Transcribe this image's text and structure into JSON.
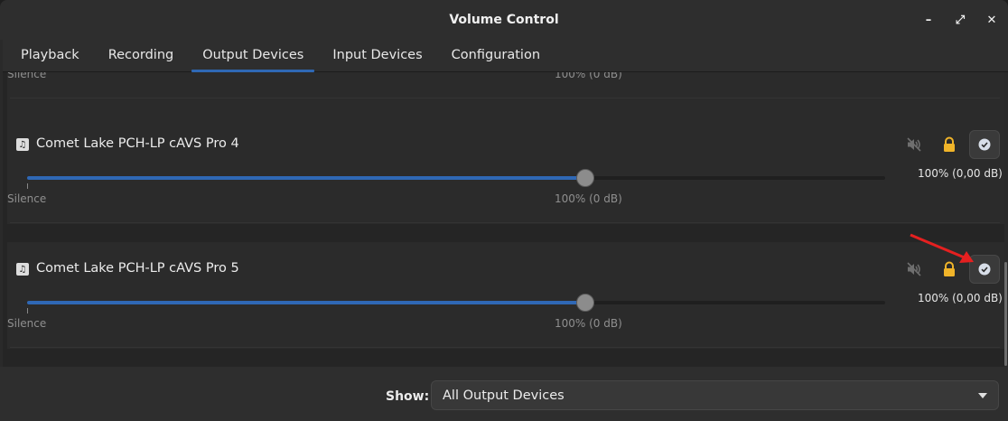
{
  "window": {
    "title": "Volume Control",
    "minimize_glyph": "–",
    "maximize_glyph": "⤢",
    "close_glyph": "✕"
  },
  "tabs": [
    {
      "label": "Playback",
      "active": false
    },
    {
      "label": "Recording",
      "active": false
    },
    {
      "label": "Output Devices",
      "active": true
    },
    {
      "label": "Input Devices",
      "active": false
    },
    {
      "label": "Configuration",
      "active": false
    }
  ],
  "partial_row": {
    "silence_label": "Silence",
    "hundred_label": "100% (0 dB)"
  },
  "devices": [
    {
      "name": "Comet Lake PCH-LP cAVS Pro 4",
      "volume_readout": "100% (0,00 dB)",
      "volume_percent": 65,
      "silence_label": "Silence",
      "hundred_label": "100% (0 dB)",
      "icon": "music-note-icon"
    },
    {
      "name": "Comet Lake PCH-LP cAVS Pro 5",
      "volume_readout": "100% (0,00 dB)",
      "volume_percent": 65,
      "silence_label": "Silence",
      "hundred_label": "100% (0 dB)",
      "icon": "music-note-icon"
    }
  ],
  "footer": {
    "show_label": "Show:",
    "show_value": "All Output Devices"
  },
  "colors": {
    "accent": "#2f68b5",
    "lock": "#f0b429",
    "annotation_arrow": "#e52020"
  }
}
